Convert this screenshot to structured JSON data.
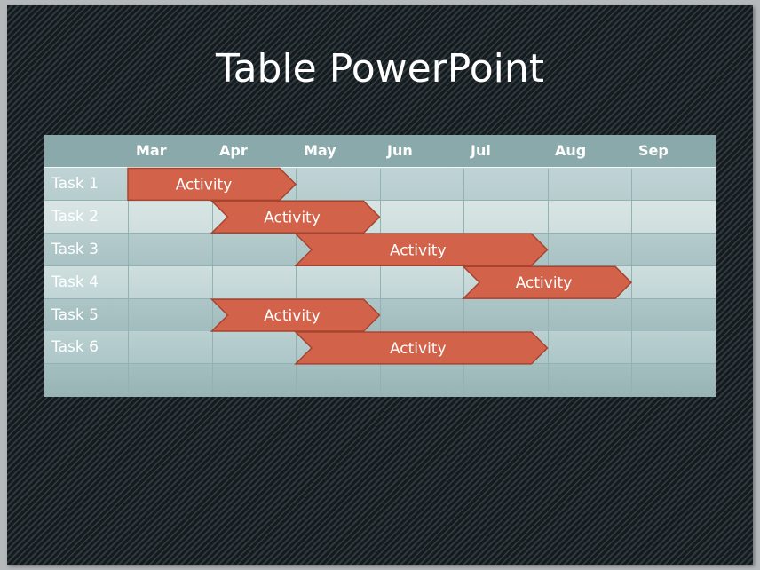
{
  "title": "Table PowerPoint",
  "colors": {
    "bar_fill": "#d2634a",
    "bar_stroke": "#a7442f",
    "header_bg": "#89a9aa",
    "slide_bg": "#141a1d"
  },
  "table": {
    "corner_label": "",
    "months": [
      "Mar",
      "Apr",
      "May",
      "Jun",
      "Jul",
      "Aug",
      "Sep"
    ],
    "tasks": [
      {
        "label": "Task 1",
        "activity": "Activity",
        "start": 0,
        "end": 2,
        "flat_start": true
      },
      {
        "label": "Task 2",
        "activity": "Activity",
        "start": 1,
        "end": 3,
        "flat_start": false
      },
      {
        "label": "Task 3",
        "activity": "Activity",
        "start": 2,
        "end": 5,
        "flat_start": false
      },
      {
        "label": "Task 4",
        "activity": "Activity",
        "start": 4,
        "end": 6,
        "flat_start": false
      },
      {
        "label": "Task 5",
        "activity": "Activity",
        "start": 1,
        "end": 3,
        "flat_start": false
      },
      {
        "label": "Task 6",
        "activity": "Activity",
        "start": 2,
        "end": 5,
        "flat_start": false
      }
    ],
    "empty_rows": 1
  }
}
